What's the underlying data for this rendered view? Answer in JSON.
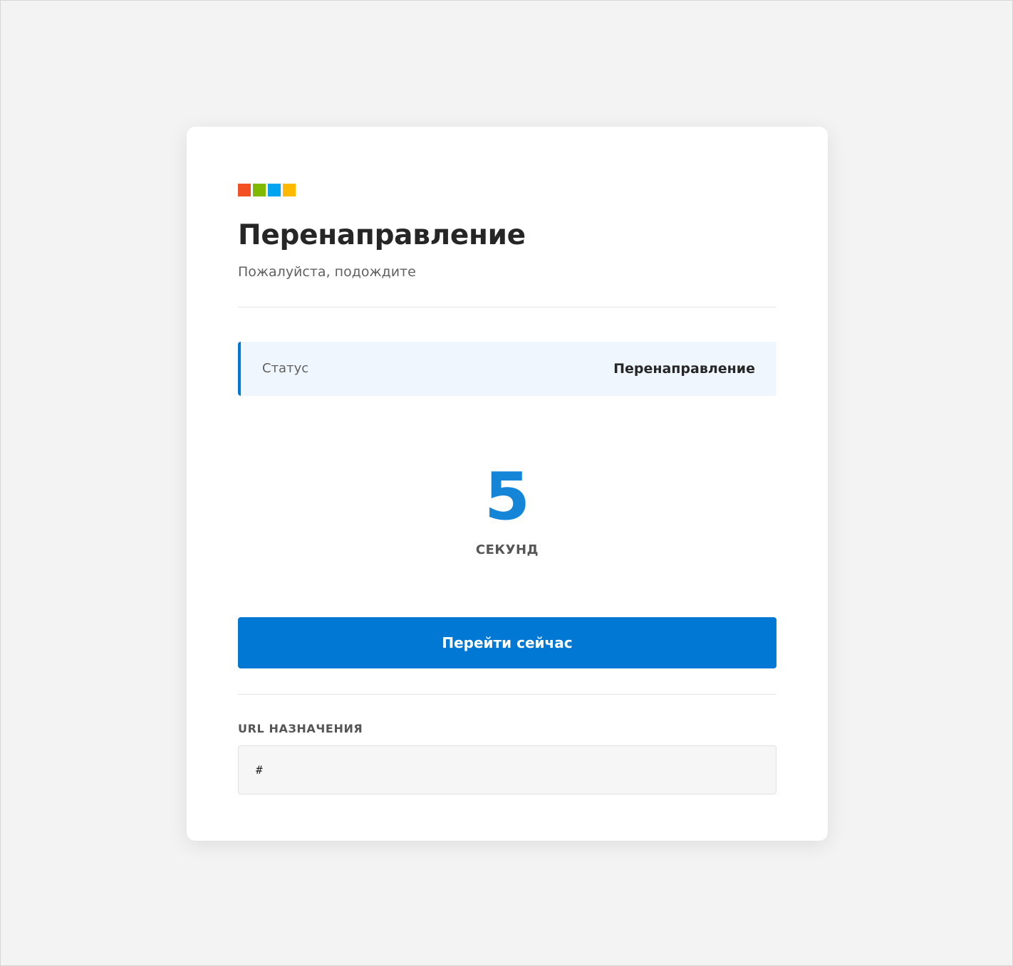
{
  "logo": {
    "colors": [
      "#f25022",
      "#7fba00",
      "#00a4ef",
      "#ffb900"
    ]
  },
  "header": {
    "title": "Перенаправление",
    "subtitle": "Пожалуйста, подождите"
  },
  "status": {
    "label": "Статус",
    "value": "Перенаправление"
  },
  "countdown": {
    "number": "5",
    "unit": "СЕКУНД"
  },
  "actions": {
    "go_now_label": "Перейти сейчас"
  },
  "destination": {
    "label": "URL НАЗНАЧЕНИЯ",
    "url": "#"
  },
  "colors": {
    "accent": "#0078d4",
    "countdown": "#1585d8",
    "background": "#f3f3f3"
  }
}
